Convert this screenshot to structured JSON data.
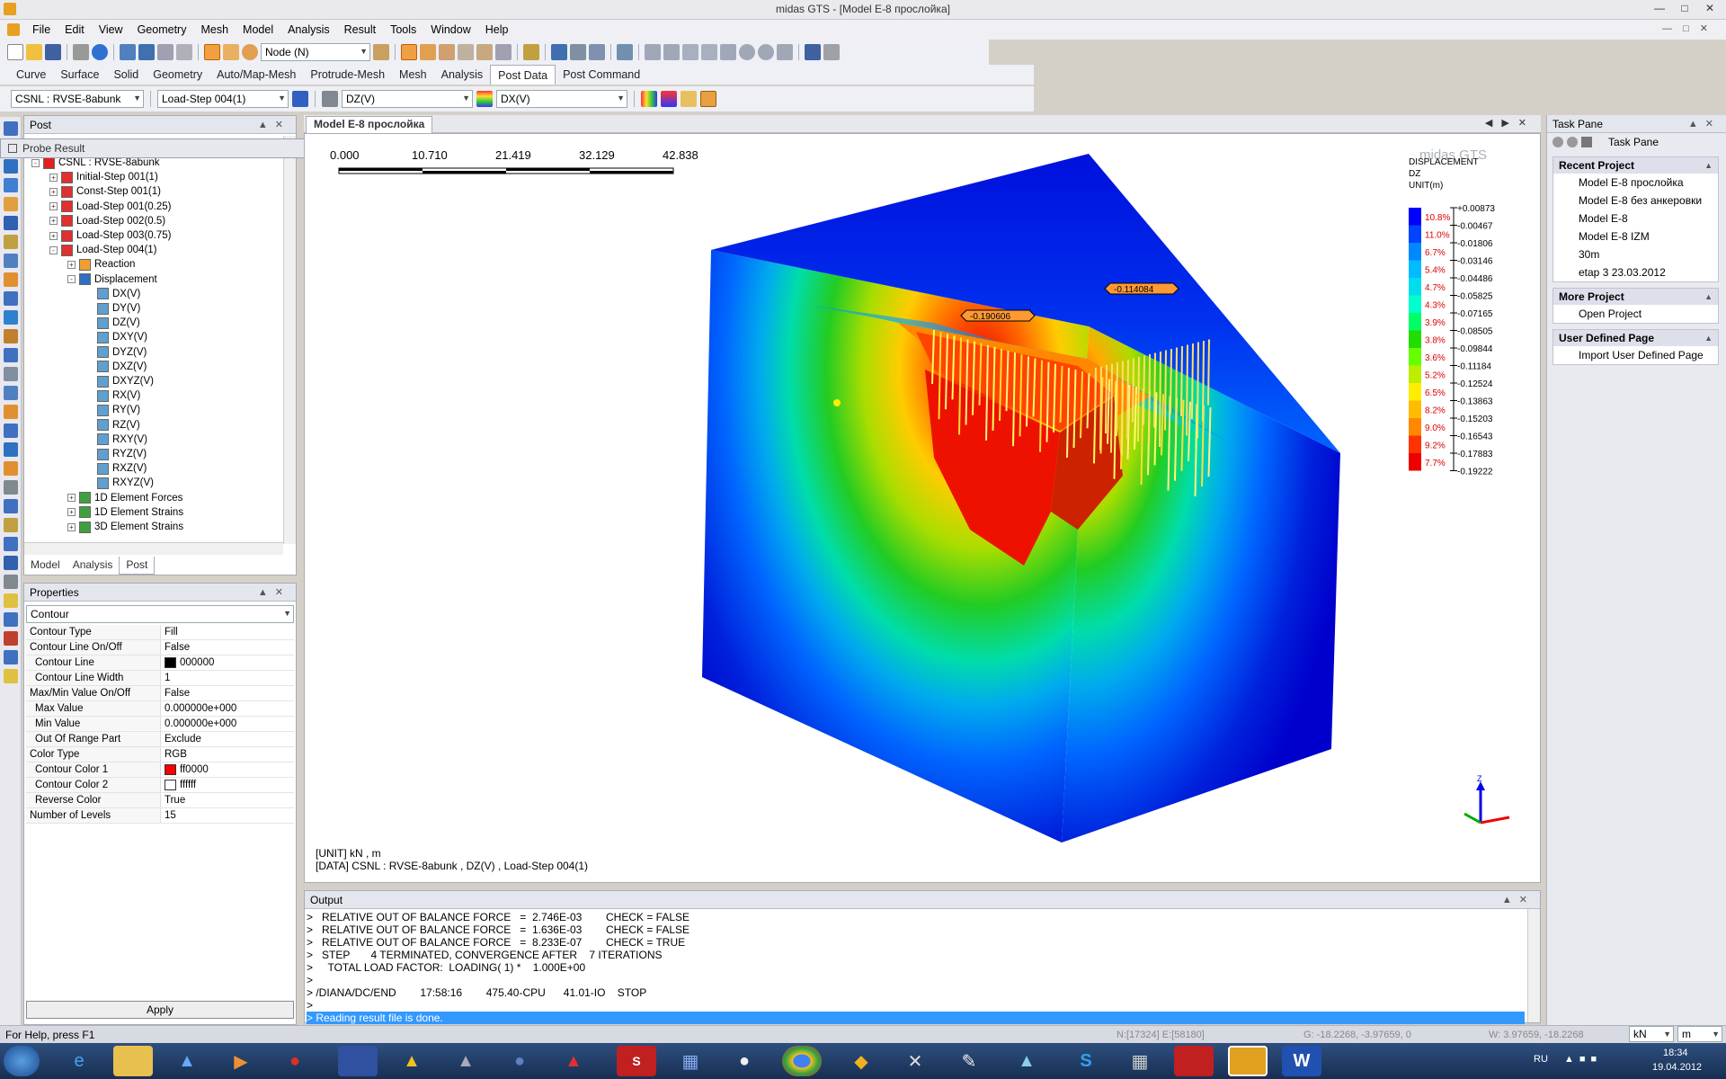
{
  "window": {
    "title": "midas GTS - [Model E-8 прослойка]"
  },
  "menu": [
    "File",
    "Edit",
    "View",
    "Geometry",
    "Mesh",
    "Model",
    "Analysis",
    "Result",
    "Tools",
    "Window",
    "Help"
  ],
  "toolbar": {
    "select_mode": "Node (N)"
  },
  "ribbon_tabs": [
    "Curve",
    "Surface",
    "Solid",
    "Geometry",
    "Auto/Map-Mesh",
    "Protrude-Mesh",
    "Mesh",
    "Analysis",
    "Post Data",
    "Post Command"
  ],
  "ribbon_active": "Post Data",
  "post_toolbar": {
    "csnl": "CSNL : RVSE-8abunk",
    "step": "Load-Step 004(1)",
    "component": "DZ(V)",
    "component2": "DX(V)"
  },
  "post_pane": {
    "title": "Post",
    "probe_title": "Probe Result",
    "tree": [
      {
        "label": "CSNL : RVSE-8abunk",
        "level": 1,
        "exp": "-",
        "icon": "red"
      },
      {
        "label": "Initial-Step 001(1)",
        "level": 2,
        "exp": "+",
        "icon": "step"
      },
      {
        "label": "Const-Step 001(1)",
        "level": 2,
        "exp": "+",
        "icon": "step"
      },
      {
        "label": "Load-Step 001(0.25)",
        "level": 2,
        "exp": "+",
        "icon": "step"
      },
      {
        "label": "Load-Step 002(0.5)",
        "level": 2,
        "exp": "+",
        "icon": "step"
      },
      {
        "label": "Load-Step 003(0.75)",
        "level": 2,
        "exp": "+",
        "icon": "step"
      },
      {
        "label": "Load-Step 004(1)",
        "level": 2,
        "exp": "-",
        "icon": "step"
      },
      {
        "label": "Reaction",
        "level": 3,
        "exp": "+",
        "icon": "react"
      },
      {
        "label": "Displacement",
        "level": 3,
        "exp": "-",
        "icon": "disp"
      },
      {
        "label": "DX(V)",
        "level": 4,
        "exp": "",
        "icon": "comp"
      },
      {
        "label": "DY(V)",
        "level": 4,
        "exp": "",
        "icon": "comp"
      },
      {
        "label": "DZ(V)",
        "level": 4,
        "exp": "",
        "icon": "comp"
      },
      {
        "label": "DXY(V)",
        "level": 4,
        "exp": "",
        "icon": "comp"
      },
      {
        "label": "DYZ(V)",
        "level": 4,
        "exp": "",
        "icon": "comp"
      },
      {
        "label": "DXZ(V)",
        "level": 4,
        "exp": "",
        "icon": "comp"
      },
      {
        "label": "DXYZ(V)",
        "level": 4,
        "exp": "",
        "icon": "comp"
      },
      {
        "label": "RX(V)",
        "level": 4,
        "exp": "",
        "icon": "comp"
      },
      {
        "label": "RY(V)",
        "level": 4,
        "exp": "",
        "icon": "comp"
      },
      {
        "label": "RZ(V)",
        "level": 4,
        "exp": "",
        "icon": "comp"
      },
      {
        "label": "RXY(V)",
        "level": 4,
        "exp": "",
        "icon": "comp"
      },
      {
        "label": "RYZ(V)",
        "level": 4,
        "exp": "",
        "icon": "comp"
      },
      {
        "label": "RXZ(V)",
        "level": 4,
        "exp": "",
        "icon": "comp"
      },
      {
        "label": "RXYZ(V)",
        "level": 4,
        "exp": "",
        "icon": "comp"
      },
      {
        "label": "1D Element Forces",
        "level": 3,
        "exp": "+",
        "icon": "force"
      },
      {
        "label": "1D Element Strains",
        "level": 3,
        "exp": "+",
        "icon": "force"
      },
      {
        "label": "3D Element Strains",
        "level": 3,
        "exp": "+",
        "icon": "force"
      }
    ],
    "tabs": [
      "Model",
      "Analysis",
      "Post"
    ],
    "active_tab": "Post"
  },
  "properties": {
    "title": "Properties",
    "selector": "Contour",
    "rows": [
      {
        "k": "Contour Type",
        "v": "Fill",
        "ind": false
      },
      {
        "k": "Contour Line On/Off",
        "v": "False",
        "ind": false
      },
      {
        "k": "Contour Line",
        "v": "000000",
        "ind": true,
        "sw": "#000000"
      },
      {
        "k": "Contour Line Width",
        "v": "1",
        "ind": true
      },
      {
        "k": "Max/Min Value On/Off",
        "v": "False",
        "ind": false
      },
      {
        "k": "Max Value",
        "v": "0.000000e+000",
        "ind": true
      },
      {
        "k": "Min Value",
        "v": "0.000000e+000",
        "ind": true
      },
      {
        "k": "Out Of Range Part",
        "v": "Exclude",
        "ind": true
      },
      {
        "k": "Color Type",
        "v": "RGB",
        "ind": false
      },
      {
        "k": "Contour Color 1",
        "v": "ff0000",
        "ind": true,
        "sw": "#ff0000"
      },
      {
        "k": "Contour Color 2",
        "v": "ffffff",
        "ind": true,
        "sw": "#ffffff"
      },
      {
        "k": "Reverse Color",
        "v": "True",
        "ind": true
      },
      {
        "k": "Number of Levels",
        "v": "15",
        "ind": false
      }
    ],
    "apply": "Apply"
  },
  "view": {
    "tab": "Model E-8 прослойка",
    "brand": "midas GTS",
    "scale_ticks": [
      "0.000",
      "10.710",
      "21.419",
      "32.129",
      "42.838"
    ],
    "legend_title": [
      "DISPLACEMENT",
      "DZ",
      "UNIT(m)"
    ],
    "legend_values": [
      "+0.00873",
      "-0.00467",
      "-0.01806",
      "-0.03146",
      "-0.04486",
      "-0.05825",
      "-0.07165",
      "-0.08505",
      "-0.09844",
      "-0.11184",
      "-0.12524",
      "-0.13863",
      "-0.15203",
      "-0.16543",
      "-0.17883",
      "-0.19222"
    ],
    "legend_pcts": [
      "10.8%",
      "11.0%",
      "6.7%",
      "5.4%",
      "4.7%",
      "4.3%",
      "3.9%",
      "3.8%",
      "3.6%",
      "5.2%",
      "6.5%",
      "8.2%",
      "9.0%",
      "9.2%",
      "7.7%"
    ],
    "legend_colors": [
      "#0000ff",
      "#0044ff",
      "#0088ff",
      "#00bbff",
      "#00ddee",
      "#00ffcc",
      "#00ff66",
      "#22dd00",
      "#66ff00",
      "#bbee00",
      "#ffee00",
      "#ffbb00",
      "#ff8800",
      "#ff3300",
      "#ee0000"
    ],
    "probe1": "-0.114084",
    "probe2": "-0.190606",
    "unit_line": "[UNIT]  kN  ,  m",
    "data_line": "[DATA]  CSNL : RVSE-8abunk ,  DZ(V) ,  Load-Step 004(1)"
  },
  "output": {
    "title": "Output",
    "lines": [
      ">   RELATIVE OUT OF BALANCE FORCE   =  2.746E-03        CHECK = FALSE",
      ">   RELATIVE OUT OF BALANCE FORCE   =  1.636E-03        CHECK = FALSE",
      ">   RELATIVE OUT OF BALANCE FORCE   =  8.233E-07        CHECK = TRUE",
      ">   STEP       4 TERMINATED, CONVERGENCE AFTER    7 ITERATIONS",
      ">     TOTAL LOAD FACTOR:  LOADING( 1) *    1.000E+00",
      ">",
      "> /DIANA/DC/END        17:58:16        475.40-CPU      41.01-IO    STOP",
      ">"
    ],
    "highlight": "> Reading result file is done."
  },
  "taskpane": {
    "title": "Task Pane",
    "header_label": "Task Pane",
    "sections": [
      {
        "title": "Recent Project",
        "items": [
          "Model E-8 прослойка",
          "Model E-8 без анкеровки",
          "Model E-8",
          "Model E-8 IZM",
          "30m",
          "etap 3 23.03.2012"
        ]
      },
      {
        "title": "More Project",
        "items": [
          "Open Project"
        ]
      },
      {
        "title": "User Defined Page",
        "items": [
          "Import User Defined Page"
        ]
      }
    ]
  },
  "statusbar": {
    "help": "For Help, press F1",
    "nodes": "N:[17324]  E:[58180]",
    "g": "G: -18.2268, -3.97659, 0",
    "w": "W: 3.97659, -18.2268",
    "unit1": "kN",
    "unit2": "m"
  },
  "taskbar": {
    "lang": "RU",
    "time": "18:34",
    "date": "19.04.2012"
  }
}
